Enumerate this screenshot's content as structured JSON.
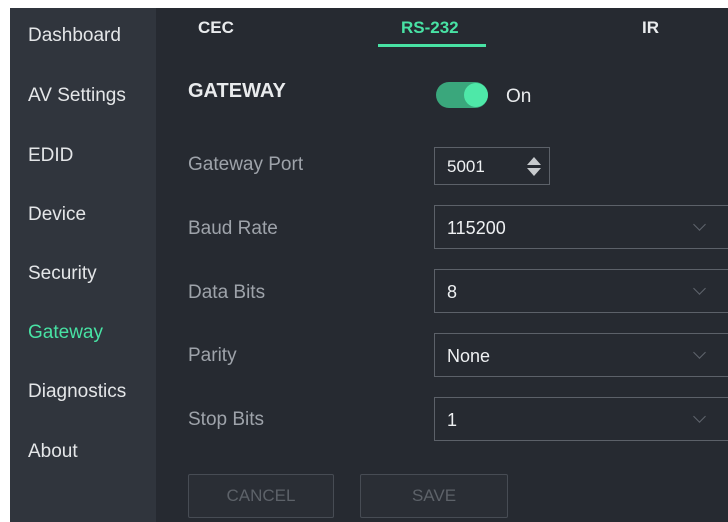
{
  "sidebar": {
    "items": [
      {
        "label": "Dashboard"
      },
      {
        "label": "AV Settings"
      },
      {
        "label": "EDID"
      },
      {
        "label": "Device"
      },
      {
        "label": "Security"
      },
      {
        "label": "Gateway"
      },
      {
        "label": "Diagnostics"
      },
      {
        "label": "About"
      }
    ],
    "active": "Gateway"
  },
  "tabs": [
    {
      "label": "CEC"
    },
    {
      "label": "RS-232"
    },
    {
      "label": "IR"
    }
  ],
  "active_tab": "RS-232",
  "gateway": {
    "title": "GATEWAY",
    "toggle": {
      "state_label": "On",
      "enabled": true
    },
    "fields": {
      "gateway_port": {
        "label": "Gateway Port",
        "value": "5001"
      },
      "baud_rate": {
        "label": "Baud Rate",
        "value": "115200"
      },
      "data_bits": {
        "label": "Data Bits",
        "value": "8"
      },
      "parity": {
        "label": "Parity",
        "value": "None"
      },
      "stop_bits": {
        "label": "Stop Bits",
        "value": "1"
      }
    },
    "buttons": {
      "cancel": "CANCEL",
      "save": "SAVE"
    }
  },
  "colors": {
    "accent": "#48e2a4",
    "background": "#262a31",
    "sidebar_background": "#30353d"
  }
}
